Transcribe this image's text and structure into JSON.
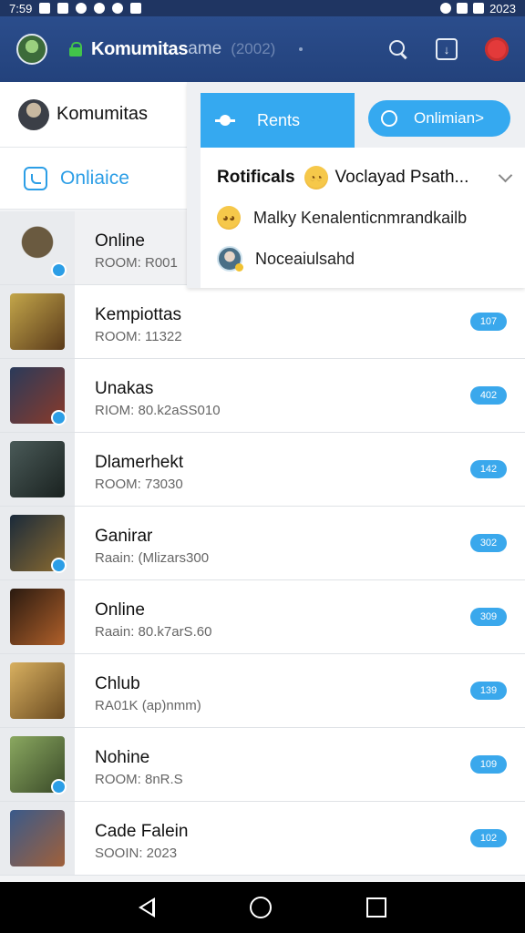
{
  "status_bar": {
    "time": "7:59",
    "clock_right": "2023"
  },
  "app_bar": {
    "title": "Komumitas",
    "title_suffix": "ame",
    "subtitle": "(2002)"
  },
  "sidebar": {
    "title": "Komumitas",
    "tab_label": "Onliaice"
  },
  "overlay": {
    "rents_label": "Rents",
    "onlimian_label": "Onlimian>",
    "notif_title": "Rotificals",
    "notif_head_text": "Voclayad Psath...",
    "lines": [
      {
        "text": "Malky Kenalenticnmrandkailb"
      },
      {
        "text": "Noceaiulsahd"
      }
    ]
  },
  "rooms": [
    {
      "title": "Online",
      "sub": "ROOM: R001",
      "badge": "",
      "color": "#8a8f6a"
    },
    {
      "title": "Kempiottas",
      "sub": "ROOM: 11322",
      "badge": "107",
      "color": "#c3a64a"
    },
    {
      "title": "Unakas",
      "sub": "RIOM: 80.k2aSS010",
      "badge": "402",
      "color": "#7a4a3a"
    },
    {
      "title": "Dlamerhekt",
      "sub": "ROOM: 73030",
      "badge": "142",
      "color": "#3e4a46"
    },
    {
      "title": "Ganirar",
      "sub": "Raain: (Mlizars300",
      "badge": "302",
      "color": "#6a5530"
    },
    {
      "title": "Online",
      "sub": "Raain: 80.k7arS.60",
      "badge": "309",
      "color": "#7a3a1a"
    },
    {
      "title": "Chlub",
      "sub": "RA01K (ap)nmm)",
      "badge": "139",
      "color": "#b89048"
    },
    {
      "title": "Nohine",
      "sub": "ROOM: 8nR.S",
      "badge": "109",
      "color": "#6a8a48"
    },
    {
      "title": "Cade Falein",
      "sub": "SOOIN: 2023",
      "badge": "102",
      "color": "#3a5a8a"
    }
  ]
}
